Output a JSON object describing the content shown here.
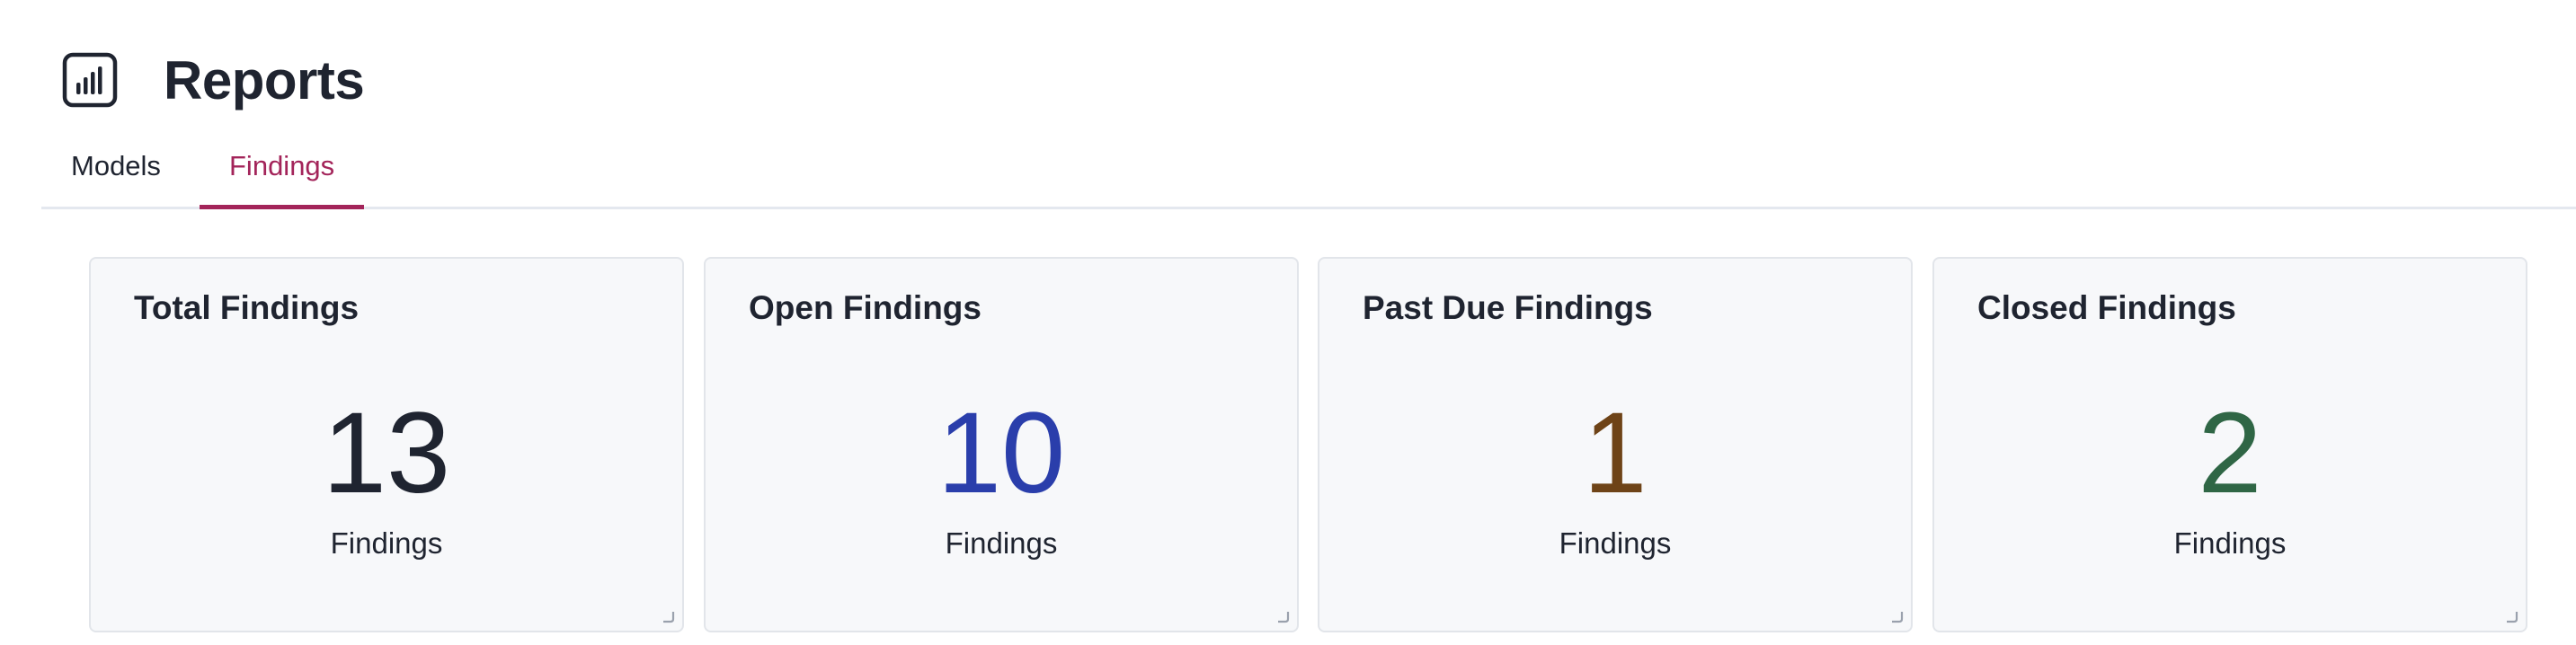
{
  "header": {
    "title": "Reports",
    "icon": "bar-chart-icon"
  },
  "tabs": [
    {
      "label": "Models",
      "active": false
    },
    {
      "label": "Findings",
      "active": true
    }
  ],
  "colors": {
    "accent": "#a3245a",
    "total": "#1f2430",
    "open": "#2a3eab",
    "past_due": "#6e4317",
    "closed": "#2f6645"
  },
  "cards": [
    {
      "title": "Total Findings",
      "value": "13",
      "unit": "Findings"
    },
    {
      "title": "Open Findings",
      "value": "10",
      "unit": "Findings"
    },
    {
      "title": "Past Due Findings",
      "value": "1",
      "unit": "Findings"
    },
    {
      "title": "Closed Findings",
      "value": "2",
      "unit": "Findings"
    }
  ]
}
